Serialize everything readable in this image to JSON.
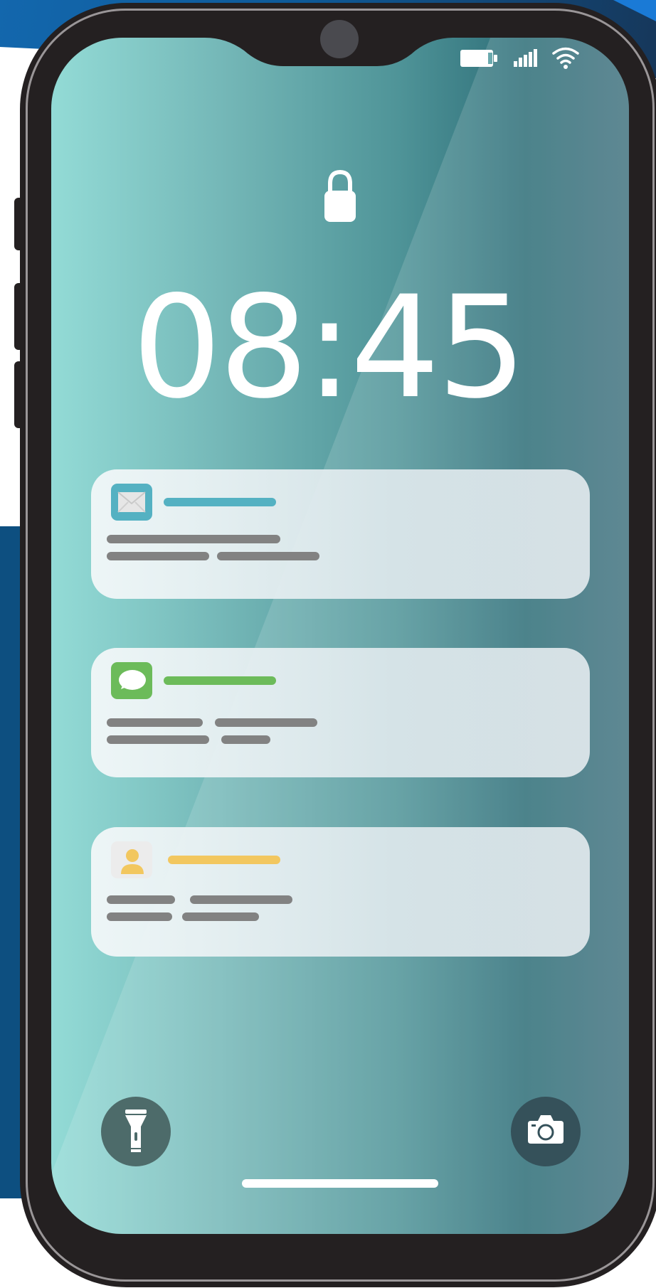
{
  "lockscreen": {
    "time": "08:45",
    "status_icons": [
      "battery-icon",
      "signal-icon",
      "wifi-icon"
    ],
    "lock_icon": "lock-icon"
  },
  "notifications": [
    {
      "app_icon": "mail-icon",
      "accent_color": "#54b1c2",
      "icon_bg": "#54b1c2"
    },
    {
      "app_icon": "message-icon",
      "accent_color": "#6cbb5a",
      "icon_bg": "#6cbb5a"
    },
    {
      "app_icon": "contact-icon",
      "accent_color": "#f2c75f",
      "icon_bg": "#ececec"
    }
  ],
  "quick_actions": {
    "left": "flashlight-icon",
    "right": "camera-icon"
  },
  "colors": {
    "phone_body": "#242021",
    "screen_gradient_start": "#93dbd6",
    "screen_gradient_end": "#2f6f79",
    "card_text_placeholder": "#828282"
  }
}
